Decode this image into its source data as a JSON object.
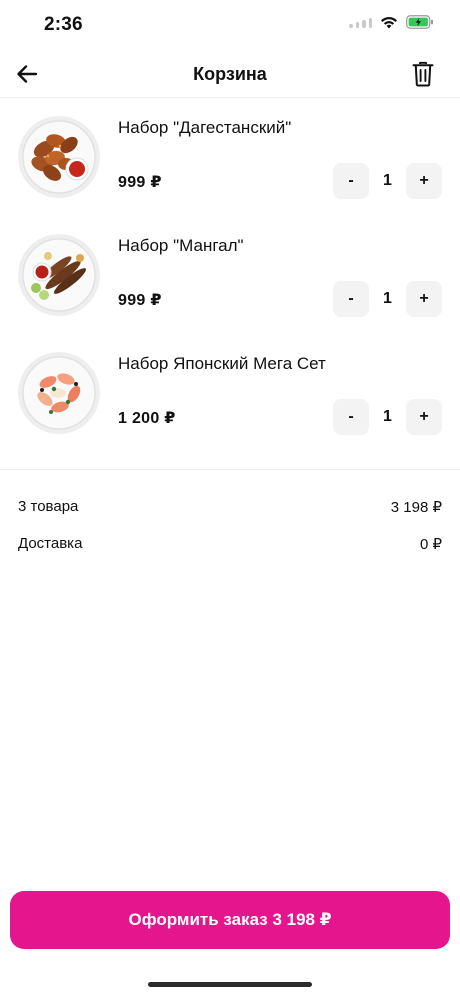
{
  "status_bar": {
    "time": "2:36"
  },
  "header": {
    "title": "Корзина",
    "back_icon": "arrow-left-icon",
    "trash_icon": "trash-icon"
  },
  "items": [
    {
      "name": "Набор \"Дагестанский\"",
      "price": "999 ₽",
      "quantity": "1",
      "minus_label": "-",
      "plus_label": "+"
    },
    {
      "name": "Набор \"Мангал\"",
      "price": "999 ₽",
      "quantity": "1",
      "minus_label": "-",
      "plus_label": "+"
    },
    {
      "name": "Набор Японский Мега Сет",
      "price": "1 200 ₽",
      "quantity": "1",
      "minus_label": "-",
      "plus_label": "+"
    }
  ],
  "summary": {
    "items_count_label": "3 товара",
    "items_total": "3 198 ₽",
    "delivery_label": "Доставка",
    "delivery_price": "0 ₽"
  },
  "checkout": {
    "label": "Оформить заказ 3 198 ₽"
  },
  "colors": {
    "accent": "#e5158d",
    "stepper_bg": "#f3f3f3",
    "battery": "#34c759"
  }
}
